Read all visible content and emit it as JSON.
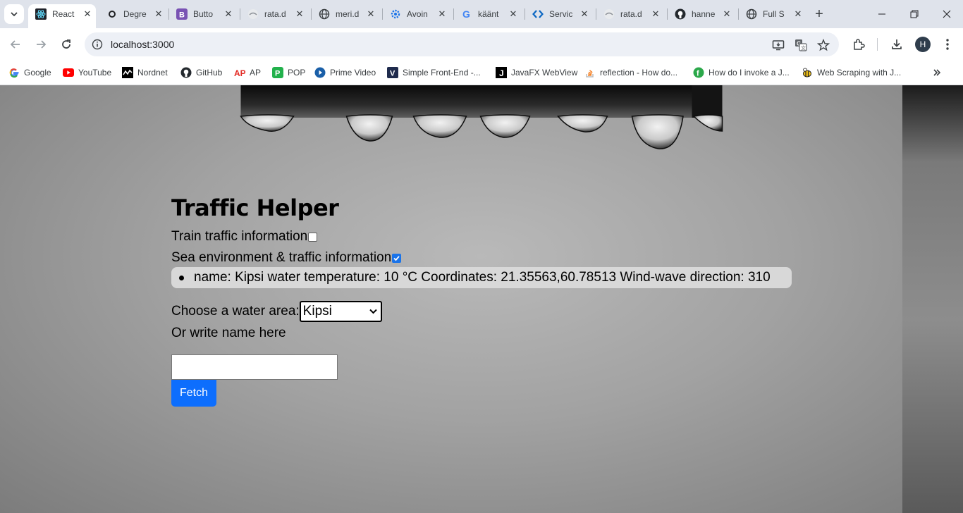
{
  "browser": {
    "tabs": [
      {
        "title": "React",
        "icon": "react-icon",
        "active": true
      },
      {
        "title": "Degre",
        "icon": "circle-icon"
      },
      {
        "title": "Butto",
        "icon": "bootstrap-icon"
      },
      {
        "title": "rata.d",
        "icon": "site-icon"
      },
      {
        "title": "meri.d",
        "icon": "globe-icon"
      },
      {
        "title": "Avoin",
        "icon": "gear-icon"
      },
      {
        "title": "käänt",
        "icon": "google-icon"
      },
      {
        "title": "Servic",
        "icon": "code-icon"
      },
      {
        "title": "rata.d",
        "icon": "site-icon"
      },
      {
        "title": "hanne",
        "icon": "github-icon"
      },
      {
        "title": "Full S",
        "icon": "globe-icon"
      }
    ],
    "url": "localhost:3000",
    "avatar_letter": "H",
    "bookmarks": [
      {
        "label": "Google",
        "icon": "google-icon",
        "color": "#ffffff"
      },
      {
        "label": "YouTube",
        "icon": "youtube-icon",
        "color": "#ff0000"
      },
      {
        "label": "Nordnet",
        "icon": "nordnet-icon",
        "color": "#000000"
      },
      {
        "label": "GitHub",
        "icon": "github-icon",
        "color": "#24292e"
      },
      {
        "label": "AP",
        "icon": "ap-icon",
        "color": "#e32b25"
      },
      {
        "label": "POP",
        "icon": "pop-icon",
        "color": "#22b14c"
      },
      {
        "label": "Prime Video",
        "icon": "prime-icon",
        "color": "#1a98ff"
      },
      {
        "label": "Simple Front-End -...",
        "icon": "v-icon",
        "color": "#1f2b4d"
      },
      {
        "label": "JavaFX WebView",
        "icon": "j-icon",
        "color": "#000000"
      },
      {
        "label": "reflection - How do...",
        "icon": "stackoverflow-icon",
        "color": "#f48024"
      },
      {
        "label": "How do I invoke a J...",
        "icon": "leaf-icon",
        "color": "#2ba84a"
      },
      {
        "label": "Web Scraping with J...",
        "icon": "bee-icon",
        "color": "#f5c518"
      }
    ]
  },
  "app": {
    "title": "Traffic Helper",
    "train_label": "Train traffic information",
    "train_checked": false,
    "sea_label": "Sea environment & traffic information",
    "sea_checked": true,
    "result_item": "name: Kipsi water temperature: 10 °C Coordinates: 21.35563,60.78513 Wind-wave direction: 310",
    "choose_label": "Choose a water area:",
    "selected_area": "Kipsi",
    "or_write_label": "Or write name here",
    "search_value": "",
    "fetch_label": "Fetch",
    "accent_color": "#0d6efd"
  }
}
